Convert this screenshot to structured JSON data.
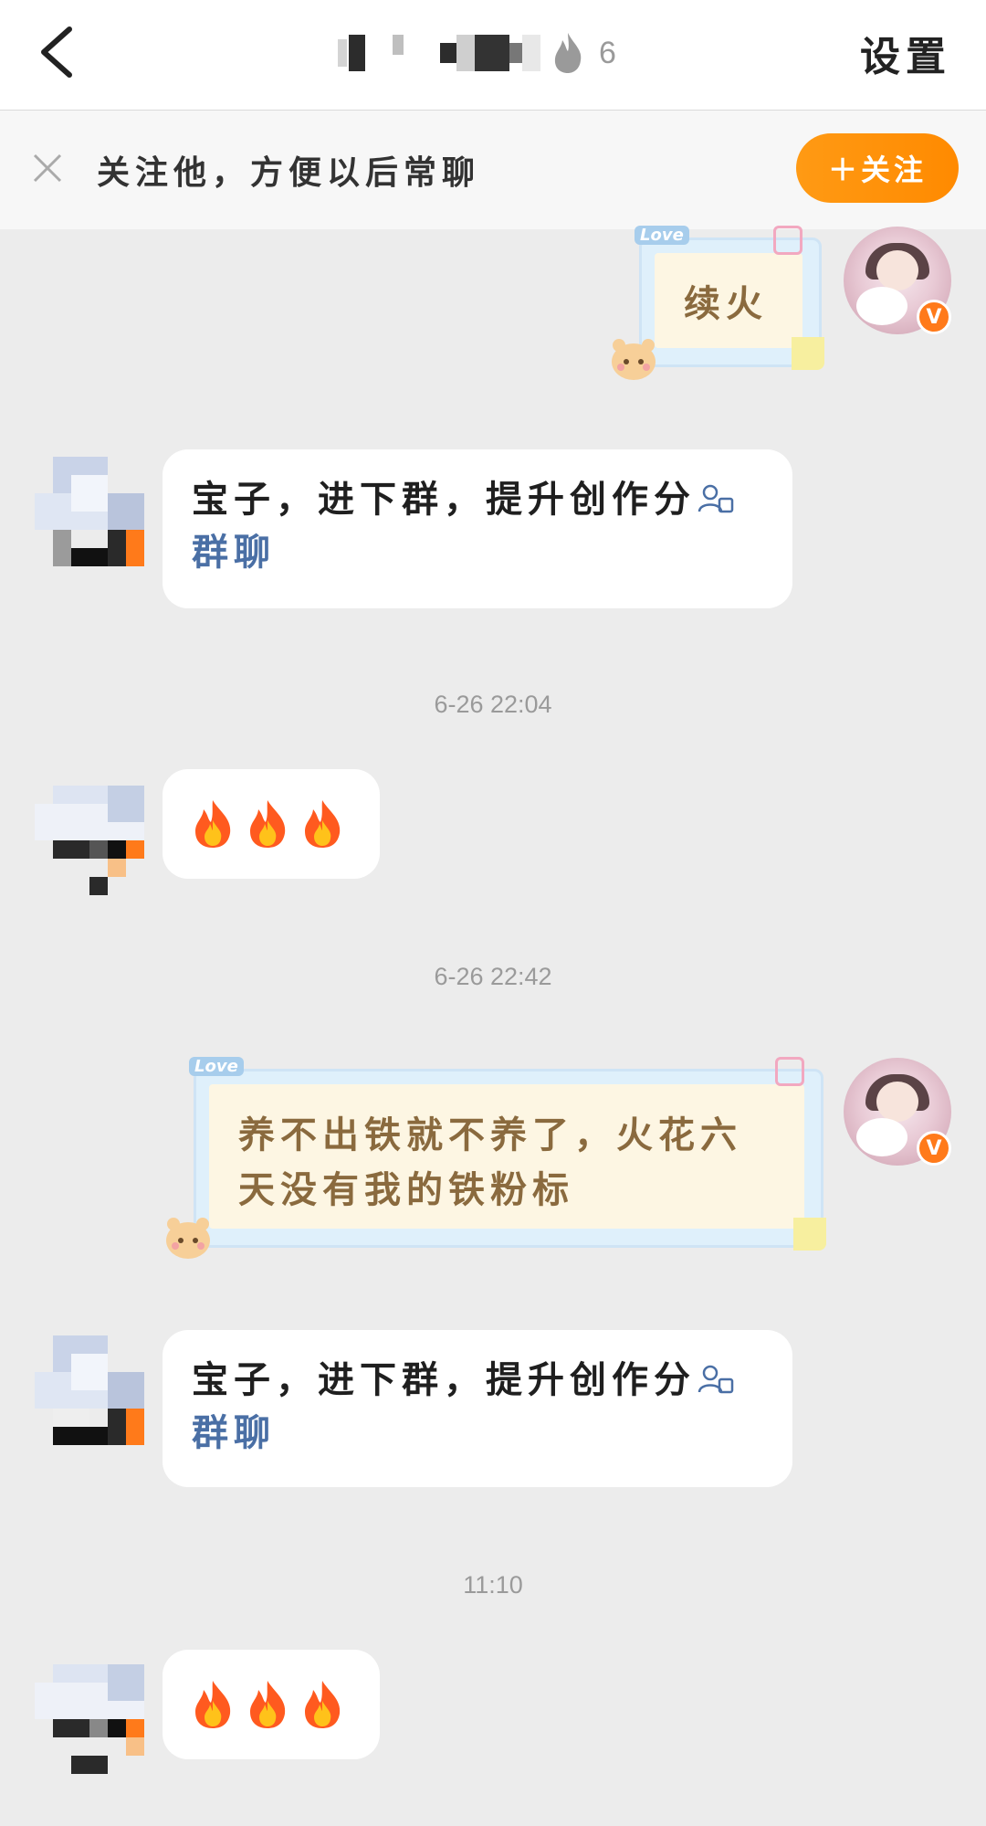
{
  "header": {
    "streak_count": "6",
    "settings_label": "设置"
  },
  "banner": {
    "text": "关注他，方便以后常聊",
    "follow_label": "＋关注"
  },
  "messages": {
    "m1_text": "续火",
    "m2_text": "宝子，进下群，提升创作分",
    "m2_link": "群聊",
    "ts1": "6-26 22:04",
    "m3_fires": "🔥🔥🔥",
    "ts2": "6-26 22:42",
    "m4_line1": "养不出铁就不养了，火花六",
    "m4_line2": "天没有我的铁粉标",
    "m5_text": "宝子，进下群，提升创作分",
    "m5_link": "群聊",
    "ts3": "11:10",
    "m6_fires": "🔥🔥🔥",
    "note_sticker": "Love",
    "vip_badge": "V"
  },
  "colors": {
    "accent_orange": "#ff8a00",
    "link_blue": "#4a6fa5",
    "note_text": "#8a6a3e",
    "chat_bg": "#ececec"
  },
  "icons": {
    "back": "chevron-left-icon",
    "flame": "flame-icon",
    "close": "close-icon",
    "group": "group-chat-icon",
    "fire": "fire-emoji-icon"
  }
}
